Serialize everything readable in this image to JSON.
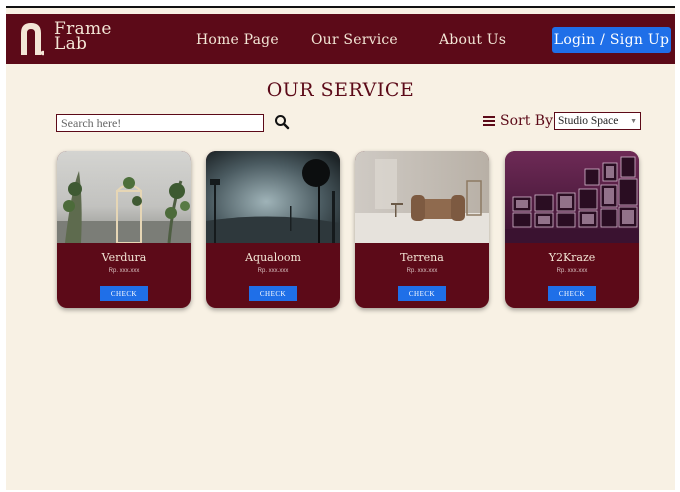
{
  "brand": {
    "line1": "Frame",
    "line2": "Lab"
  },
  "nav": {
    "home": "Home Page",
    "service": "Our Service",
    "about": "About Us",
    "login": "Login / Sign Up"
  },
  "page": {
    "title": "OUR SERVICE"
  },
  "search": {
    "placeholder": "Search here!"
  },
  "sort": {
    "label": "Sort By",
    "selected": "Studio Space"
  },
  "cards": [
    {
      "name": "Verdura",
      "price": "Rp. xxx.xxx",
      "button": "CHECK"
    },
    {
      "name": "Aqualoom",
      "price": "Rp. xxx.xxx",
      "button": "CHECK"
    },
    {
      "name": "Terrena",
      "price": "Rp. xxx.xxx",
      "button": "CHECK"
    },
    {
      "name": "Y2Kraze",
      "price": "Rp. xxx.xxx",
      "button": "CHECK"
    }
  ],
  "colors": {
    "brand": "#5c0a18",
    "accent": "#1f6fe8",
    "background": "#f8f1e4"
  }
}
